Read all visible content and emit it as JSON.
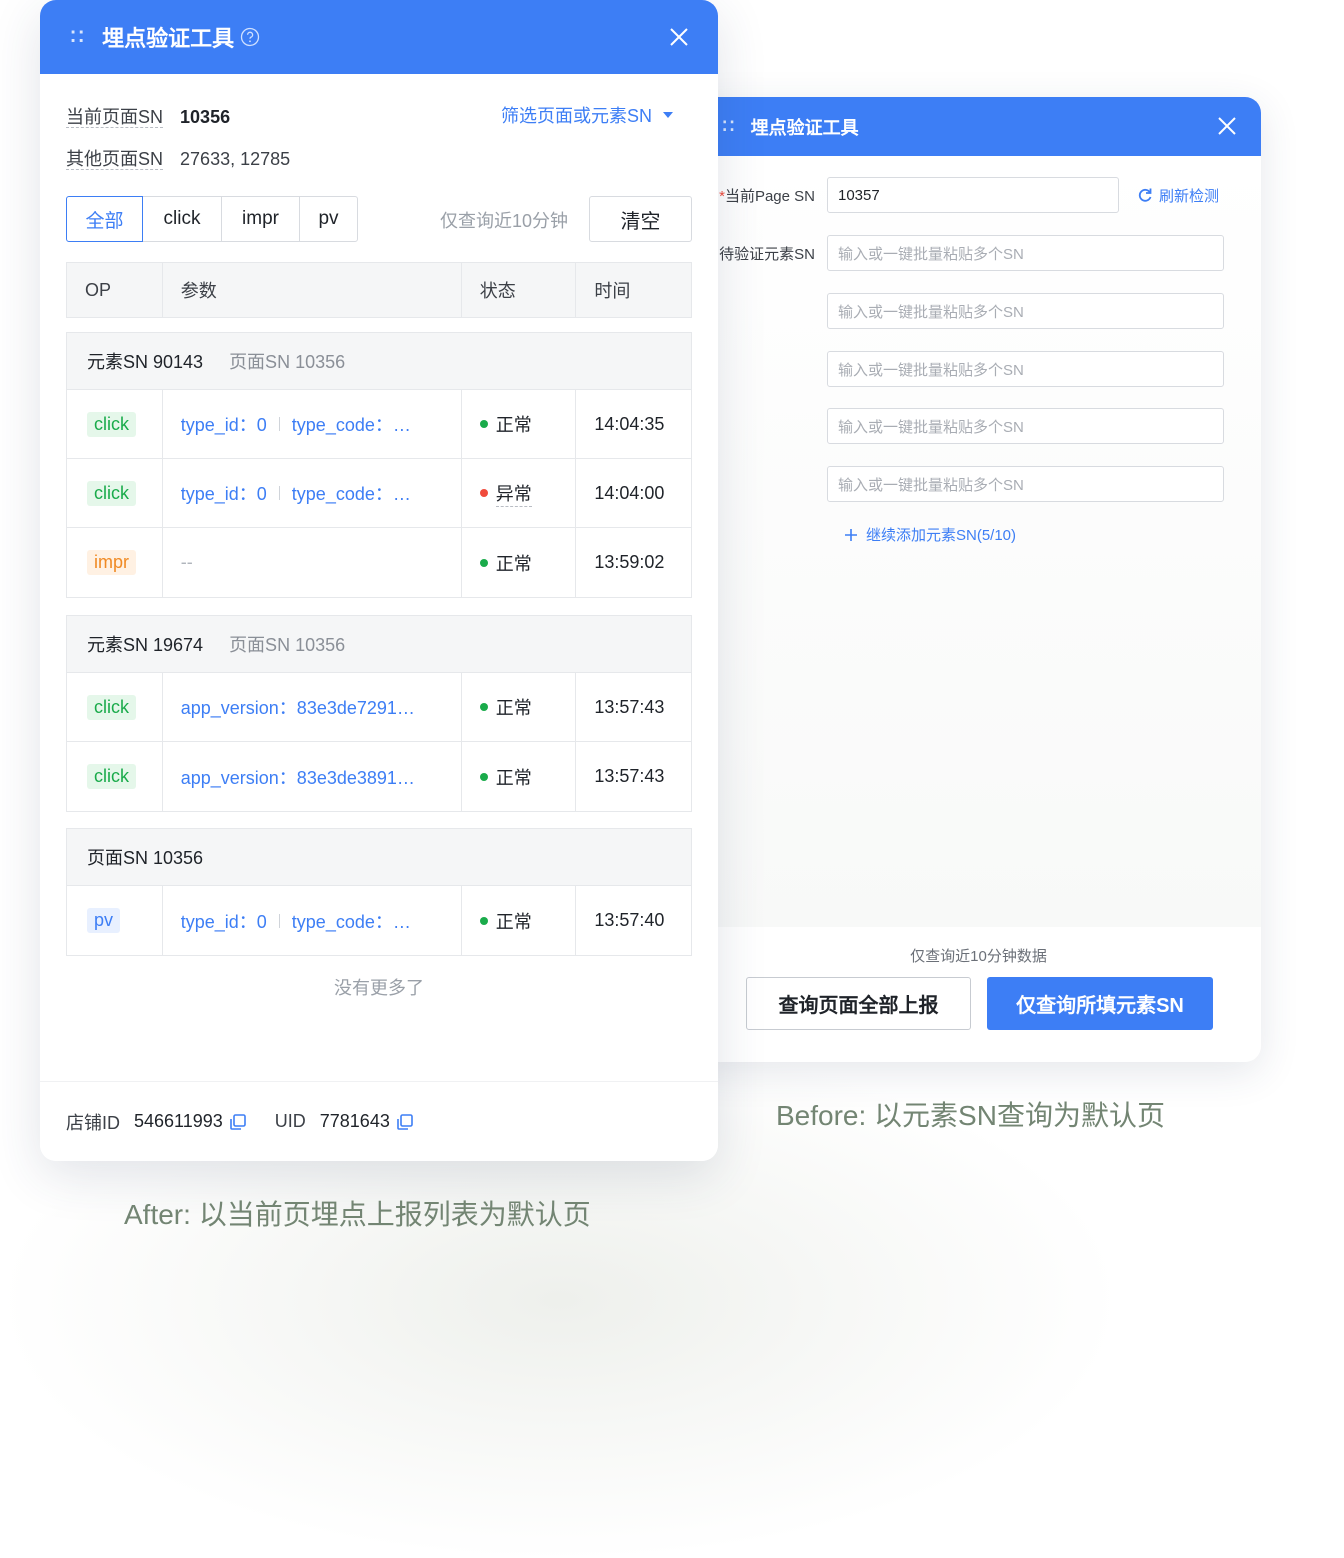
{
  "colors": {
    "accent": "#3d7ef5",
    "success": "#1aab4b",
    "error": "#f04b3c",
    "warning": "#f08a24"
  },
  "before": {
    "title": "埋点验证工具",
    "current_page_label_star": "*",
    "current_page_label": "当前Page SN",
    "current_page_value": "10357",
    "refresh_label": "刷新检测",
    "element_label": "待验证元素SN",
    "element_placeholder": "输入或一键批量粘贴多个SN",
    "add_more_label": "继续添加元素SN(5/10)",
    "note": "仅查询近10分钟数据",
    "btn_all": "查询页面全部上报",
    "btn_filled": "仅查询所填元素SN"
  },
  "captions": {
    "before": "Before: 以元素SN查询为默认页",
    "after": "After: 以当前页埋点上报列表为默认页"
  },
  "after": {
    "title": "埋点验证工具",
    "current_page_key": "当前页面SN",
    "current_page_value": "10356",
    "other_pages_key": "其他页面SN",
    "other_pages_value": "27633, 12785",
    "filter_label": "筛选页面或元素SN",
    "segments": [
      "全部",
      "click",
      "impr",
      "pv"
    ],
    "recent_note": "仅查询近10分钟",
    "clear_label": "清空",
    "columns": [
      "OP",
      "参数",
      "状态",
      "时间"
    ],
    "groups": [
      {
        "element": "元素SN 90143",
        "page": "页面SN 10356",
        "rows": [
          {
            "op": "click",
            "p1": "type_id：0",
            "p2": "type_code：…",
            "status": "正常",
            "time": "14:04:35"
          },
          {
            "op": "click",
            "p1": "type_id：0",
            "p2": "type_code：…",
            "status": "异常",
            "time": "14:04:00"
          },
          {
            "op": "impr",
            "p1": "--",
            "status": "正常",
            "time": "13:59:02"
          }
        ]
      },
      {
        "element": "元素SN 19674",
        "page": "页面SN 10356",
        "rows": [
          {
            "op": "click",
            "p1": "app_version：83e3de7291…",
            "status": "正常",
            "time": "13:57:43"
          },
          {
            "op": "click",
            "p1": "app_version：83e3de3891…",
            "status": "正常",
            "time": "13:57:43"
          }
        ]
      },
      {
        "element": "页面SN 10356",
        "rows": [
          {
            "op": "pv",
            "p1": "type_id：0",
            "p2": "type_code：…",
            "status": "正常",
            "time": "13:57:40"
          }
        ]
      }
    ],
    "no_more": "没有更多了",
    "shop_key": "店铺ID",
    "shop_value": "546611993",
    "uid_key": "UID",
    "uid_value": "7781643"
  }
}
